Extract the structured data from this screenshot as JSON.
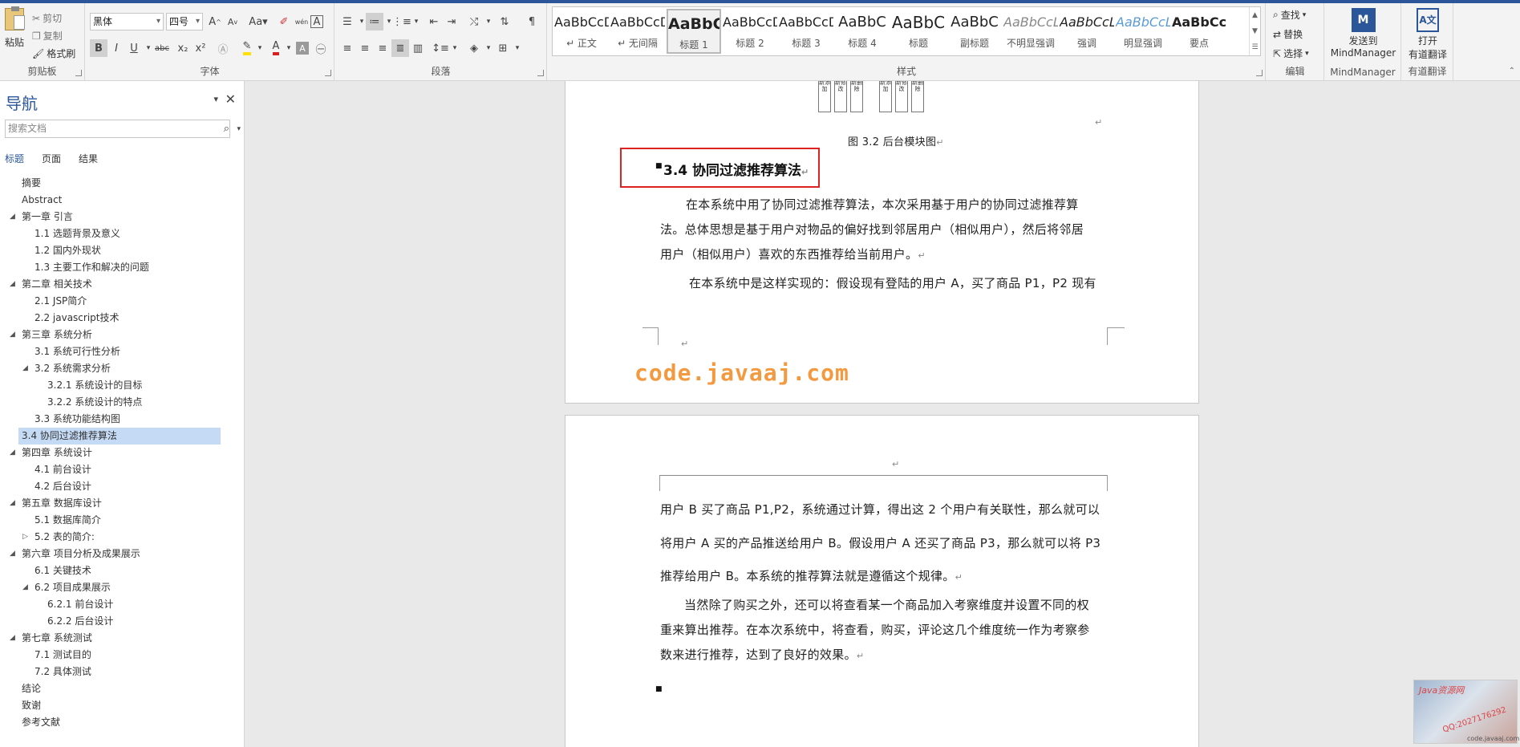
{
  "ribbon": {
    "clipboard": {
      "paste": "粘贴",
      "cut": "剪切",
      "copy": "复制",
      "format_painter": "格式刷",
      "label": "剪贴板"
    },
    "font": {
      "name": "黑体",
      "size": "四号",
      "bold": "B",
      "italic": "I",
      "underline": "U",
      "strike": "abc",
      "sub": "x₂",
      "sup": "x²",
      "label": "字体",
      "grow": "A",
      "shrink": "A",
      "case": "Aa",
      "phonetic": "wén",
      "border_char": "A",
      "font_color": "A",
      "shade": "A",
      "highlight_color": "#ffe000",
      "font_color_hex": "#d62020"
    },
    "paragraph": {
      "label": "段落"
    },
    "styles": {
      "label": "样式",
      "items": [
        {
          "sample": "AaBbCcD",
          "name": "↵ 正文"
        },
        {
          "sample": "AaBbCcD",
          "name": "↵ 无间隔"
        },
        {
          "sample": "AaBbC",
          "name": "标题 1"
        },
        {
          "sample": "AaBbCcD",
          "name": "标题 2"
        },
        {
          "sample": "AaBbCcD",
          "name": "标题 3"
        },
        {
          "sample": "AaBbC",
          "name": "标题 4"
        },
        {
          "sample": "AaBbC",
          "name": "标题"
        },
        {
          "sample": "AaBbC",
          "name": "副标题"
        },
        {
          "sample": "AaBbCcL",
          "name": "不明显强调"
        },
        {
          "sample": "AaBbCcL",
          "name": "强调"
        },
        {
          "sample": "AaBbCcL",
          "name": "明显强调"
        },
        {
          "sample": "AaBbCcl",
          "name": "要点"
        }
      ]
    },
    "editing": {
      "find": "查找",
      "replace": "替换",
      "select": "选择",
      "label": "编辑"
    },
    "mindmanager": {
      "send": "发送到",
      "app": "MindManager",
      "label": "MindManager"
    },
    "youdao": {
      "open": "打开",
      "translate": "有道翻译",
      "label": "有道翻译"
    }
  },
  "nav": {
    "title": "导航",
    "search_placeholder": "搜索文档",
    "tabs": [
      "标题",
      "页面",
      "结果"
    ],
    "items": [
      {
        "text": "摘要",
        "level": 1,
        "arrow": ""
      },
      {
        "text": "Abstract",
        "level": 1,
        "arrow": ""
      },
      {
        "text": "第一章 引言",
        "level": 1,
        "arrow": "◢"
      },
      {
        "text": "1.1 选题背景及意义",
        "level": 2,
        "arrow": ""
      },
      {
        "text": "1.2 国内外现状",
        "level": 2,
        "arrow": ""
      },
      {
        "text": "1.3 主要工作和解决的问题",
        "level": 2,
        "arrow": ""
      },
      {
        "text": "第二章 相关技术",
        "level": 1,
        "arrow": "◢"
      },
      {
        "text": "2.1 JSP简介",
        "level": 2,
        "arrow": ""
      },
      {
        "text": "2.2 javascript技术",
        "level": 2,
        "arrow": ""
      },
      {
        "text": "第三章 系统分析",
        "level": 1,
        "arrow": "◢"
      },
      {
        "text": "3.1 系统可行性分析",
        "level": 2,
        "arrow": ""
      },
      {
        "text": "3.2 系统需求分析",
        "level": 2,
        "arrow": "◢"
      },
      {
        "text": "3.2.1 系统设计的目标",
        "level": 3,
        "arrow": ""
      },
      {
        "text": "3.2.2 系统设计的特点",
        "level": 3,
        "arrow": ""
      },
      {
        "text": "3.3 系统功能结构图",
        "level": 2,
        "arrow": ""
      },
      {
        "text": "3.4 协同过滤推荐算法",
        "level": 1,
        "arrow": "",
        "selected": true
      },
      {
        "text": "第四章 系统设计",
        "level": 1,
        "arrow": "◢"
      },
      {
        "text": "4.1 前台设计",
        "level": 2,
        "arrow": ""
      },
      {
        "text": "4.2 后台设计",
        "level": 2,
        "arrow": ""
      },
      {
        "text": "第五章 数据库设计",
        "level": 1,
        "arrow": "◢"
      },
      {
        "text": "5.1 数据库简介",
        "level": 2,
        "arrow": ""
      },
      {
        "text": "5.2 表的简介:",
        "level": 2,
        "arrow": "▷"
      },
      {
        "text": "第六章 项目分析及成果展示",
        "level": 1,
        "arrow": "◢"
      },
      {
        "text": "6.1 关键技术",
        "level": 2,
        "arrow": ""
      },
      {
        "text": "6.2 项目成果展示",
        "level": 2,
        "arrow": "◢"
      },
      {
        "text": "6.2.1 前台设计",
        "level": 3,
        "arrow": ""
      },
      {
        "text": "6.2.2 后台设计",
        "level": 3,
        "arrow": ""
      },
      {
        "text": "第七章 系统测试",
        "level": 1,
        "arrow": "◢"
      },
      {
        "text": "7.1 测试目的",
        "level": 2,
        "arrow": ""
      },
      {
        "text": "7.2 具体测试",
        "level": 2,
        "arrow": ""
      },
      {
        "text": "结论",
        "level": 1,
        "arrow": ""
      },
      {
        "text": "致谢",
        "level": 1,
        "arrow": ""
      },
      {
        "text": "参考文献",
        "level": 1,
        "arrow": ""
      }
    ]
  },
  "doc": {
    "figure_boxes": [
      "新添加",
      "新修改",
      "新删除",
      "新添加",
      "新修改",
      "新删除"
    ],
    "figure_caption": "图 3.2  后台模块图",
    "heading": "3.4  协同过滤推荐算法",
    "p1_lines": [
      "在本系统中用了协同过滤推荐算法，本次采用基于用户的协同过滤推荐算",
      "法。总体思想是基于用户对物品的偏好找到邻居用户（相似用户），然后将邻居",
      "用户（相似用户）喜欢的东西推荐给当前用户。"
    ],
    "p2_line": "在本系统中是这样实现的：假设现有登陆的用户 A，买了商品 P1，P2 现有",
    "watermark": "code.javaaj.com",
    "page2_lines": [
      "用户 B 买了商品 P1,P2，系统通过计算，得出这 2 个用户有关联性，那么就可以",
      "将用户 A 买的产品推送给用户 B。假设用户 A 还买了商品 P3，那么就可以将 P3",
      "推荐给用户 B。本系统的推荐算法就是遵循这个规律。"
    ],
    "page2_p2_lines": [
      "当然除了购买之外，还可以将查看某一个商品加入考察维度并设置不同的权",
      "重来算出推荐。在本次系统中，将查看，购买，评论这几个维度统一作为考察参",
      "数来进行推荐，达到了良好的效果。"
    ],
    "para_mark": "↵"
  },
  "corner": {
    "line1": "Java资源网",
    "line2": "QQ:2027176292",
    "line3": "code.javaaj.com"
  }
}
